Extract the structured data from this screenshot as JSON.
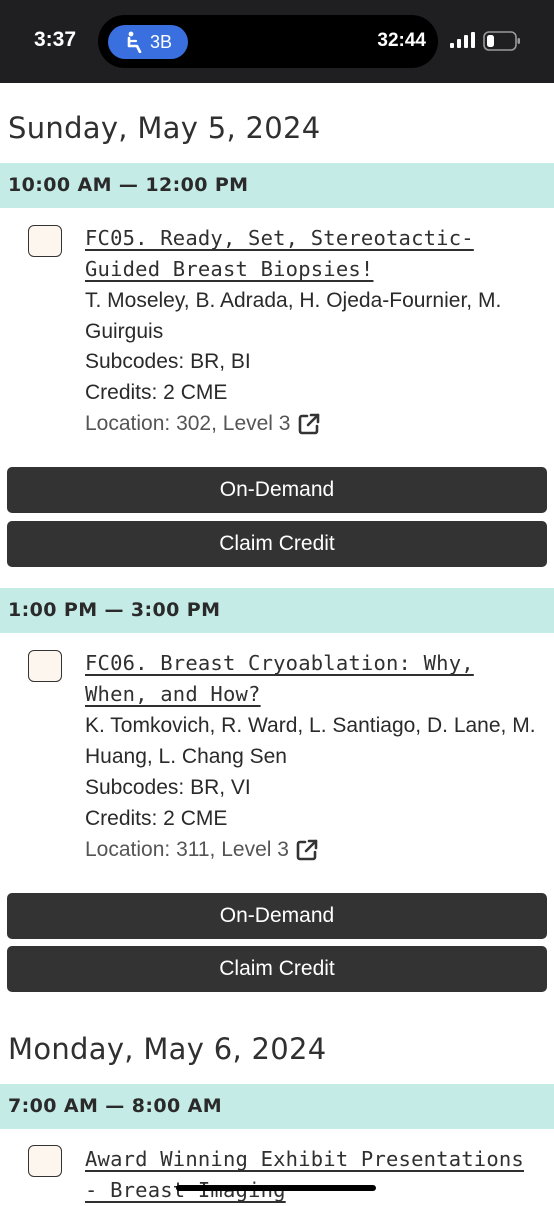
{
  "status_bar": {
    "time": "3:37",
    "seat_label": "3B",
    "timer": "32:44",
    "icons": [
      "seat-icon",
      "signal-icon",
      "battery-icon"
    ]
  },
  "days": [
    {
      "heading": "Sunday, May 5, 2024",
      "slots": [
        {
          "time": "10:00 AM — 12:00 PM",
          "title": "FC05. Ready, Set, Stereotactic-Guided Breast Biopsies!",
          "authors": "T. Moseley, B. Adrada, H. Ojeda-Fournier, M. Guirguis",
          "subcodes": "Subcodes: BR, BI",
          "credits": "Credits: 2 CME",
          "location": "Location: 302, Level 3",
          "on_demand_label": "On-Demand",
          "claim_credit_label": "Claim Credit"
        },
        {
          "time": "1:00 PM — 3:00 PM",
          "title": "FC06. Breast Cryoablation: Why, When, and How?",
          "authors": "K. Tomkovich, R. Ward, L. Santiago, D. Lane, M. Huang, L. Chang Sen",
          "subcodes": "Subcodes: BR, VI",
          "credits": "Credits: 2 CME",
          "location": "Location: 311, Level 3",
          "on_demand_label": "On-Demand",
          "claim_credit_label": "Claim Credit"
        }
      ]
    },
    {
      "heading": "Monday, May 6, 2024",
      "slots": [
        {
          "time": "7:00 AM — 8:00 AM",
          "title": "Award Winning Exhibit Presentations - Breast Imaging"
        }
      ]
    }
  ],
  "colors": {
    "status_bar_bg": "#1f1f21",
    "seat_pill": "#3a6fe0",
    "time_band": "#c5ebe6",
    "button_bg": "#333333",
    "checkbox_fill": "#fdf6ee"
  }
}
